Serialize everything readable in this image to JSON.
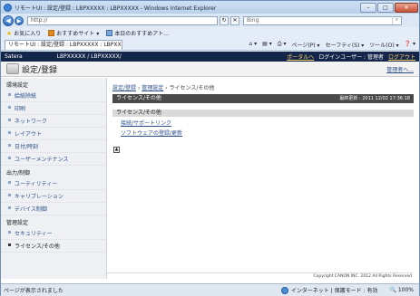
{
  "window": {
    "title": "リモートUI : 設定/登録 : LBPXXXXX : LBPXXXXX - Windows Internet Explorer",
    "min": "–",
    "max": "□",
    "close": "✕"
  },
  "address": {
    "url": "http://",
    "search_placeholder": "Bing"
  },
  "favorites": {
    "fav_label": "お気に入り",
    "suggested": "おすすめサイト ▾",
    "today": "本日のおすすめアト..."
  },
  "tab": {
    "label": "リモートUI : 設定/登録 : LBPXXXXX : LBPXX..."
  },
  "tools": {
    "home": "⌂ ▾",
    "feeds": "▤ ▾",
    "print": "⎙ ▾",
    "page": "ページ(P) ▾",
    "safety": "セーフティ(S) ▾",
    "tools": "ツール(O) ▾",
    "help": "❓ ▾"
  },
  "header": {
    "brand": "Satera",
    "device": "LBPXXXXX / LBPXXXXX/",
    "portal": "ポータルへ",
    "login_user": "ログインユーザー : 管理者",
    "logout": "ログアウト"
  },
  "settings": {
    "title": "設定/登録",
    "back": "管理者へ..."
  },
  "sidebar": {
    "sections": [
      {
        "label": "環境設定",
        "items": [
          "給紙除紙",
          "印刷",
          "ネットワーク",
          "レイアウト",
          "日付/時刻",
          "ユーザーメンテナンス"
        ]
      },
      {
        "label": "出力/制御",
        "items": [
          "ユーティリティー",
          "キャリブレーション",
          "デバイス制御"
        ]
      },
      {
        "label": "管理設定",
        "items": [
          "セキュリティー",
          "ライセンス/その他"
        ]
      }
    ]
  },
  "main": {
    "breadcrumb": [
      "設定/登録",
      "管理設定",
      "ライセンス/その他"
    ],
    "panel_title": "ライセンス/その他",
    "last_updated": "最終更新 : 2011 12/02 17:36:18",
    "sub_title": "ライセンス/その他",
    "links": [
      "接続/サポートリンク",
      "ソフトウェアの登録/更新"
    ],
    "copyright": "Copyright CANON INC. 2012 All Rights Reserved"
  },
  "status": {
    "text": "ページが表示されました",
    "zone": "インターネット | 保護モード : 有効",
    "zoom": "100%"
  }
}
